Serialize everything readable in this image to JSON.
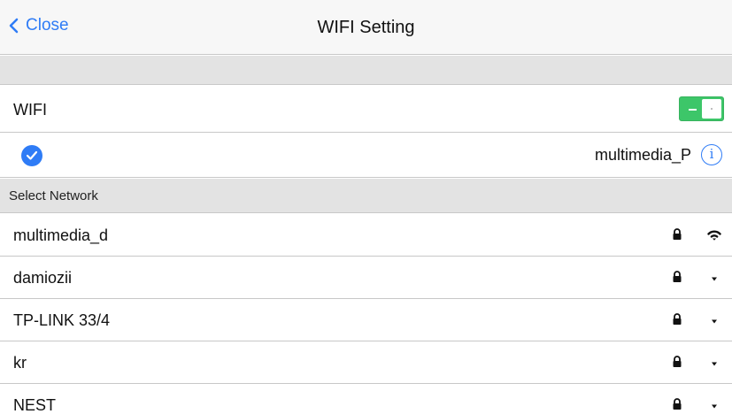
{
  "navbar": {
    "back_label": "Close",
    "title": "WIFI Setting",
    "accent_color": "#2f7cf6"
  },
  "wifi": {
    "label": "WIFI",
    "enabled": true,
    "toggle_color": "#3dc669"
  },
  "current_network": {
    "name": "multimedia_P",
    "connected": true,
    "info_glyph": "i"
  },
  "section": {
    "header": "Select Network"
  },
  "networks": [
    {
      "name": "multimedia_d",
      "secured": true,
      "signal_icon": "wifi-strong-icon"
    },
    {
      "name": "damiozii",
      "secured": true,
      "signal_icon": "wifi-weak-icon"
    },
    {
      "name": "TP-LINK 33/4",
      "secured": true,
      "signal_icon": "wifi-weak-icon"
    },
    {
      "name": "kr",
      "secured": true,
      "signal_icon": "wifi-weak-icon"
    },
    {
      "name": "NEST",
      "secured": true,
      "signal_icon": "wifi-weak-icon"
    }
  ]
}
